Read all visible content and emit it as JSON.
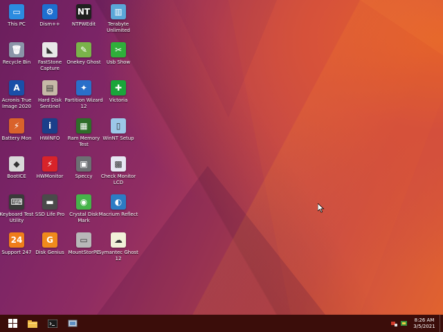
{
  "desktop": {
    "icons": [
      {
        "label": "This PC",
        "icon": "this-pc-icon",
        "color": "#2b8be0",
        "glyph": "▭"
      },
      {
        "label": "Dism++",
        "icon": "gears-icon",
        "color": "#1e6fd0",
        "glyph": "⚙"
      },
      {
        "label": "NTPWEdit",
        "icon": "ntpwedit-icon",
        "color": "#202020",
        "glyph": "NT"
      },
      {
        "label": "Terabyte Unlimited",
        "icon": "terabyte-icon",
        "color": "#5aa7d8",
        "glyph": "▥"
      },
      {
        "label": "Recycle Bin",
        "icon": "recycle-bin-icon",
        "color": "#8a95a8",
        "glyph": "🗑"
      },
      {
        "label": "FastStone Capture",
        "icon": "faststone-icon",
        "color": "#e8e8e8",
        "glyph": "◣"
      },
      {
        "label": "Onekey Ghost",
        "icon": "onekey-ghost-icon",
        "color": "#7ab34a",
        "glyph": "✎"
      },
      {
        "label": "Usb Show",
        "icon": "usb-show-icon",
        "color": "#2fae3a",
        "glyph": "✂"
      },
      {
        "label": "Acronis True Image 2020",
        "icon": "acronis-icon",
        "color": "#1a4fa8",
        "glyph": "A"
      },
      {
        "label": "Hard Disk Sentinel",
        "icon": "hdd-sentinel-icon",
        "color": "#c6b9a7",
        "glyph": "▤"
      },
      {
        "label": "Partition Wizard 12",
        "icon": "partition-wizard-icon",
        "color": "#2a6fc9",
        "glyph": "✦"
      },
      {
        "label": "Victoria",
        "icon": "victoria-cross-icon",
        "color": "#1aa53a",
        "glyph": "✚"
      },
      {
        "label": "Battery Mon",
        "icon": "battery-mon-icon",
        "color": "#d9622b",
        "glyph": "⚡"
      },
      {
        "label": "HWiNFO",
        "icon": "hwinfo-icon",
        "color": "#1b3f8a",
        "glyph": "i"
      },
      {
        "label": "Ram Memory Test",
        "icon": "ram-module-icon",
        "color": "#2f6d2a",
        "glyph": "▦"
      },
      {
        "label": "WinNT Setup",
        "icon": "winnt-setup-icon",
        "color": "#9cc7e8",
        "glyph": "▯"
      },
      {
        "label": "BootICE",
        "icon": "bootice-icon",
        "color": "#d9d9d9",
        "glyph": "◆"
      },
      {
        "label": "HWMonitor",
        "icon": "hwmonitor-icon",
        "color": "#d8232a",
        "glyph": "⚡"
      },
      {
        "label": "Speccy",
        "icon": "speccy-icon",
        "color": "#6d6f73",
        "glyph": "▣"
      },
      {
        "label": "Check Monitor LCD",
        "icon": "check-monitor-icon",
        "color": "#e6e6f2",
        "glyph": "▩"
      },
      {
        "label": "Keyboard Test Utility",
        "icon": "keyboard-test-icon",
        "color": "#3a3a3a",
        "glyph": "⌨"
      },
      {
        "label": "SSD Life Pro",
        "icon": "ssd-life-icon",
        "color": "#4a4a4a",
        "glyph": "▬"
      },
      {
        "label": "Crystal Disk Mark",
        "icon": "crystal-disk-mark-icon",
        "color": "#46b34a",
        "glyph": "◉"
      },
      {
        "label": "Macrium Reflect",
        "icon": "macrium-reflect-icon",
        "color": "#2c7cc4",
        "glyph": "◐"
      },
      {
        "label": "Support 247",
        "icon": "support-247-icon",
        "color": "#ef7d1a",
        "glyph": "24"
      },
      {
        "label": "Disk Genius",
        "icon": "disk-genius-icon",
        "color": "#f08a1c",
        "glyph": "G"
      },
      {
        "label": "MountStorPE",
        "icon": "mountstorpe-icon",
        "color": "#b8b8b8",
        "glyph": "▭"
      },
      {
        "label": "Symantec Ghost 12",
        "icon": "symantec-ghost-icon",
        "color": "#f1f1d8",
        "glyph": "☁"
      }
    ]
  },
  "taskbar": {
    "start_icon": "windows-start-icon",
    "pinned": [
      {
        "name": "file-explorer-icon",
        "color": "#f2c14e"
      },
      {
        "name": "command-prompt-icon",
        "color": "#1a1a1a"
      },
      {
        "name": "system-tool-icon",
        "color": "#c9d3df"
      }
    ],
    "tray_icons": [
      "network-icon",
      "volume-icon"
    ],
    "clock": {
      "time": "8:26 AM",
      "date": "3/5/2021"
    }
  }
}
